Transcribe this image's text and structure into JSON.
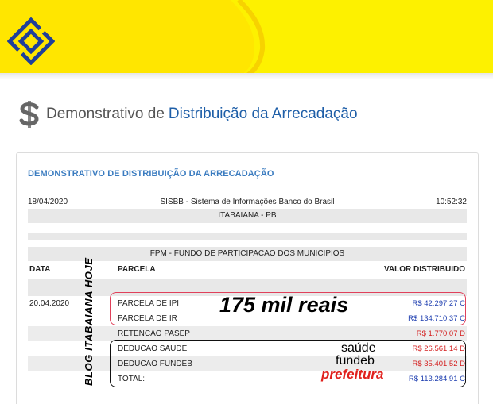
{
  "page_title": {
    "prefix": "Demonstrativo de",
    "main": "Distribuição da Arrecadação"
  },
  "panel": {
    "title": "DEMONSTRATIVO DE DISTRIBUIÇÃO DA ARRECADAÇÃO",
    "date": "18/04/2020",
    "system": "SISBB - Sistema de Informações Banco do Brasil",
    "time": "10:52:32",
    "city": "ITABAIANA - PB",
    "fund": "FPM - FUNDO DE PARTICIPACAO DOS MUNICIPIOS",
    "columns": {
      "date": "DATA",
      "parcel": "PARCELA",
      "value": "VALOR DISTRIBUIDO"
    },
    "rows": [
      {
        "date": "20.04.2020",
        "parcel": "PARCELA DE IPI",
        "value": "R$ 42.297,27 C"
      },
      {
        "date": "",
        "parcel": "PARCELA DE IR",
        "value": "R$ 134.710,37 C"
      },
      {
        "date": "",
        "parcel": "RETENCAO PASEP",
        "value": "R$ 1.770,07 D"
      },
      {
        "date": "",
        "parcel": "DEDUCAO SAUDE",
        "value": "R$ 26.561,14 D"
      },
      {
        "date": "",
        "parcel": "DEDUCAO FUNDEB",
        "value": "R$ 35.401,52 D"
      },
      {
        "date": "",
        "parcel": "TOTAL:",
        "value": "R$ 113.284,91 C"
      }
    ]
  },
  "annotations": {
    "amount": "175 mil reais",
    "health": "saúde",
    "education": "fundeb",
    "city_hall": "prefeitura",
    "blog": "BLOG ITABAIANA HOJE"
  },
  "colors": {
    "header_yellow": "#fdf100",
    "title_blue": "#1f5fa8",
    "credit_blue": "#1f3fb0",
    "debit_red": "#d42020"
  }
}
